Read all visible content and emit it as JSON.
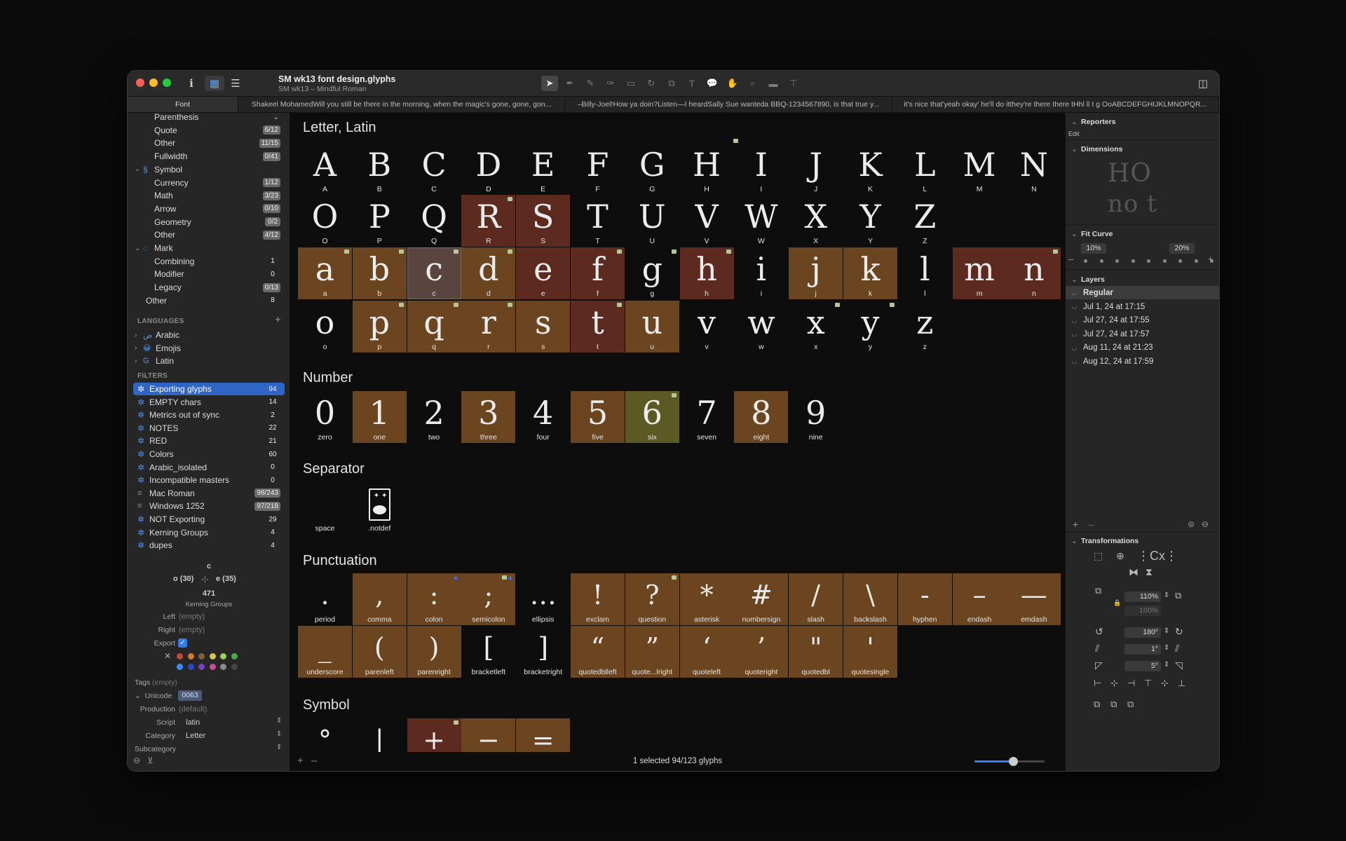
{
  "window": {
    "title": "SM wk13 font design.glyphs",
    "subtitle": "SM wk13 – Mindful Roman"
  },
  "tabs": [
    "Font",
    "Shakeel MohamedWill you still be there in the morning, when the magic's gone, gone, gon...",
    "–Billy-Joel!How ya doin?Listen—I heardSally Sue wanteda BBQ-1234567890, is  that true y...",
    "it's nice that'yeah okay' he'll do itthey're there there tHhl ll t g OoABCDEFGHIJKLMNOPQR..."
  ],
  "sidebar": {
    "categories": [
      {
        "label": "Parenthesis",
        "count": ""
      },
      {
        "label": "Quote",
        "count": "6/12"
      },
      {
        "label": "Other",
        "count": "11/15"
      },
      {
        "label": "Fullwidth",
        "count": "0/41"
      },
      {
        "label": "Symbol",
        "count": ""
      },
      {
        "label": "Currency",
        "count": "1/12"
      },
      {
        "label": "Math",
        "count": "3/23"
      },
      {
        "label": "Arrow",
        "count": "0/10"
      },
      {
        "label": "Geometry",
        "count": "0/2"
      },
      {
        "label": "Other",
        "count": "4/12"
      },
      {
        "label": "Mark",
        "count": ""
      },
      {
        "label": "Combining",
        "count": "1"
      },
      {
        "label": "Modifier",
        "count": "0"
      },
      {
        "label": "Legacy",
        "count": "0/13"
      },
      {
        "label": "Other",
        "count": "8"
      }
    ],
    "languages_heading": "LANGUAGES",
    "languages": [
      {
        "label": "Arabic",
        "icon": "ض"
      },
      {
        "label": "Emojis",
        "icon": "😀"
      },
      {
        "label": "Latin",
        "icon": "G"
      }
    ],
    "filters_heading": "FILTERS",
    "filters": [
      {
        "label": "Exporting glyphs",
        "count": "94"
      },
      {
        "label": "EMPTY chars",
        "count": "14"
      },
      {
        "label": "Metrics out of sync",
        "count": "2"
      },
      {
        "label": "NOTES",
        "count": "22"
      },
      {
        "label": "RED",
        "count": "21"
      },
      {
        "label": "Colors",
        "count": "60"
      },
      {
        "label": "Arabic_isolated",
        "count": "0"
      },
      {
        "label": "Incompatible masters",
        "count": "0"
      },
      {
        "label": "Mac Roman",
        "count": "98/243"
      },
      {
        "label": "Windows 1252",
        "count": "97/218"
      },
      {
        "label": "NOT Exporting",
        "count": "29"
      },
      {
        "label": "Kerning Groups",
        "count": "4"
      },
      {
        "label": "dupes",
        "count": "4"
      }
    ]
  },
  "inspector": {
    "glyph_name": "c",
    "left_sidebearing": "o (30)",
    "right_sidebearing": "e (35)",
    "width": "471",
    "kerning_groups": "Kerning Groups",
    "left_label": "Left",
    "left_value": "(empty)",
    "right_label": "Right",
    "right_value": "(empty)",
    "export_label": "Export",
    "tags_label": "Tags",
    "tags_value": "(empty)",
    "unicode_label": "Unicode",
    "unicode_value": "0063",
    "production_label": "Production",
    "production_value": "(default)",
    "script_label": "Script",
    "script_value": "latin",
    "category_label": "Category",
    "category_value": "Letter",
    "subcategory_label": "Subcategory",
    "colors": [
      "#c04a3a",
      "#d27a33",
      "#806040",
      "#d8c544",
      "#9bd05a",
      "#4aa84a",
      "#3a8ef0",
      "#2f45c8",
      "#7c3fc8",
      "#d04a9a",
      "#8a8a8a",
      "#444444"
    ]
  },
  "sections": [
    {
      "title": "Letter, Latin",
      "rows": [
        [
          {
            "g": "A",
            "n": "A"
          },
          {
            "g": "B",
            "n": "B"
          },
          {
            "g": "C",
            "n": "C"
          },
          {
            "g": "D",
            "n": "D"
          },
          {
            "g": "E",
            "n": "E"
          },
          {
            "g": "F",
            "n": "F"
          },
          {
            "g": "G",
            "n": "G"
          },
          {
            "g": "H",
            "n": "H",
            "badge": "note-out"
          },
          {
            "g": "I",
            "n": "I"
          },
          {
            "g": "J",
            "n": "J"
          },
          {
            "g": "K",
            "n": "K"
          },
          {
            "g": "L",
            "n": "L"
          },
          {
            "g": "M",
            "n": "M"
          },
          {
            "g": "N",
            "n": "N"
          }
        ],
        [
          {
            "g": "O",
            "n": "O"
          },
          {
            "g": "P",
            "n": "P"
          },
          {
            "g": "Q",
            "n": "Q"
          },
          {
            "g": "R",
            "n": "R",
            "bg": "#5c2a1e",
            "badge": "note"
          },
          {
            "g": "S",
            "n": "S",
            "bg": "#5c2a1e"
          },
          {
            "g": "T",
            "n": "T"
          },
          {
            "g": "U",
            "n": "U"
          },
          {
            "g": "V",
            "n": "V"
          },
          {
            "g": "W",
            "n": "W"
          },
          {
            "g": "X",
            "n": "X"
          },
          {
            "g": "Y",
            "n": "Y"
          },
          {
            "g": "Z",
            "n": "Z"
          }
        ],
        [
          {
            "g": "a",
            "n": "a",
            "bg": "#6a4520",
            "badge": "note"
          },
          {
            "g": "b",
            "n": "b",
            "bg": "#6a4520",
            "badge": "note"
          },
          {
            "g": "c",
            "n": "c",
            "bg": "#5a4440",
            "badge": "note",
            "selected": true
          },
          {
            "g": "d",
            "n": "d",
            "bg": "#6a4520",
            "badge": "note"
          },
          {
            "g": "e",
            "n": "e",
            "bg": "#5c2a1e"
          },
          {
            "g": "f",
            "n": "f",
            "bg": "#5c2a1e",
            "badge": "note"
          },
          {
            "g": "g",
            "n": "g",
            "badge": "note"
          },
          {
            "g": "h",
            "n": "h",
            "bg": "#5c2a1e",
            "badge": "note"
          },
          {
            "g": "i",
            "n": "i"
          },
          {
            "g": "j",
            "n": "j",
            "bg": "#6a4520"
          },
          {
            "g": "k",
            "n": "k",
            "bg": "#6a4520"
          },
          {
            "g": "l",
            "n": "l"
          },
          {
            "g": "m",
            "n": "m",
            "bg": "#5c2a1e"
          },
          {
            "g": "n",
            "n": "n",
            "bg": "#5c2a1e",
            "badge": "note"
          }
        ],
        [
          {
            "g": "o",
            "n": "o"
          },
          {
            "g": "p",
            "n": "p",
            "bg": "#6a4520",
            "badge": "note"
          },
          {
            "g": "q",
            "n": "q",
            "bg": "#6a4520",
            "badge": "note"
          },
          {
            "g": "r",
            "n": "r",
            "bg": "#6a4520",
            "badge": "note"
          },
          {
            "g": "s",
            "n": "s",
            "bg": "#6a4520"
          },
          {
            "g": "t",
            "n": "t",
            "bg": "#5c2a1e",
            "badge": "note"
          },
          {
            "g": "u",
            "n": "u",
            "bg": "#6a4520"
          },
          {
            "g": "v",
            "n": "v"
          },
          {
            "g": "w",
            "n": "w"
          },
          {
            "g": "x",
            "n": "x",
            "badge": "note"
          },
          {
            "g": "y",
            "n": "y",
            "badge": "note"
          },
          {
            "g": "z",
            "n": "z"
          }
        ]
      ]
    },
    {
      "title": "Number",
      "rows": [
        [
          {
            "g": "0",
            "n": "zero"
          },
          {
            "g": "1",
            "n": "one",
            "bg": "#6a4520"
          },
          {
            "g": "2",
            "n": "two"
          },
          {
            "g": "3",
            "n": "three",
            "bg": "#6a4520"
          },
          {
            "g": "4",
            "n": "four"
          },
          {
            "g": "5",
            "n": "five",
            "bg": "#6a4520"
          },
          {
            "g": "6",
            "n": "six",
            "bg": "#5c5a24",
            "badge": "note"
          },
          {
            "g": "7",
            "n": "seven"
          },
          {
            "g": "8",
            "n": "eight",
            "bg": "#6a4520"
          },
          {
            "g": "9",
            "n": "nine"
          }
        ]
      ]
    },
    {
      "title": "Separator",
      "rows": [
        [
          {
            "g": " ",
            "n": "space"
          },
          {
            "g": "notdef",
            "n": ".notdef"
          }
        ]
      ]
    },
    {
      "title": "Punctuation",
      "rows": [
        [
          {
            "g": ".",
            "n": "period"
          },
          {
            "g": ",",
            "n": "comma",
            "bg": "#6a4520"
          },
          {
            "g": ":",
            "n": "colon",
            "bg": "#6a4520",
            "badge": "blue"
          },
          {
            "g": ";",
            "n": "semicolon",
            "bg": "#6a4520",
            "badge": "both"
          },
          {
            "g": "…",
            "n": "ellipsis"
          },
          {
            "g": "!",
            "n": "exclam",
            "bg": "#6a4520"
          },
          {
            "g": "?",
            "n": "question",
            "bg": "#6a4520",
            "badge": "note"
          },
          {
            "g": "*",
            "n": "asterisk",
            "bg": "#6a4520"
          },
          {
            "g": "#",
            "n": "numbersign",
            "bg": "#6a4520"
          },
          {
            "g": "/",
            "n": "slash",
            "bg": "#6a4520"
          },
          {
            "g": "\\",
            "n": "backslash",
            "bg": "#6a4520"
          },
          {
            "g": "-",
            "n": "hyphen",
            "bg": "#6a4520"
          },
          {
            "g": "–",
            "n": "endash",
            "bg": "#6a4520"
          },
          {
            "g": "—",
            "n": "emdash",
            "bg": "#6a4520"
          }
        ],
        [
          {
            "g": "_",
            "n": "underscore",
            "bg": "#6a4520"
          },
          {
            "g": "(",
            "n": "parenleft",
            "bg": "#6a4520"
          },
          {
            "g": ")",
            "n": "parenright",
            "bg": "#6a4520"
          },
          {
            "g": "[",
            "n": "bracketleft"
          },
          {
            "g": "]",
            "n": "bracketright"
          },
          {
            "g": "“",
            "n": "quotedblleft",
            "bg": "#6a4520"
          },
          {
            "g": "”",
            "n": "quote...lright",
            "bg": "#6a4520"
          },
          {
            "g": "‘",
            "n": "quoteleft",
            "bg": "#6a4520"
          },
          {
            "g": "’",
            "n": "quoteright",
            "bg": "#6a4520"
          },
          {
            "g": "\"",
            "n": "quotedbl",
            "bg": "#6a4520"
          },
          {
            "g": "'",
            "n": "quotesingle",
            "bg": "#6a4520"
          }
        ]
      ]
    },
    {
      "title": "Symbol",
      "rows": [
        [
          {
            "g": "°",
            "n": ""
          },
          {
            "g": "|",
            "n": ""
          },
          {
            "g": "+",
            "n": "",
            "bg": "#5c2a1e",
            "badge": "note"
          },
          {
            "g": "−",
            "n": "",
            "bg": "#6a4520"
          },
          {
            "g": "=",
            "n": "",
            "bg": "#6a4520"
          }
        ]
      ]
    }
  ],
  "status": {
    "text": "1 selected 94/123 glyphs",
    "zoom_level": 0.55
  },
  "right_panel": {
    "reporters": "Reporters",
    "edit": "Edit",
    "dimensions": "Dimensions",
    "fit_curve": "Fit Curve",
    "fit_min": "10%",
    "fit_max": "20%",
    "layers": "Layers",
    "master_layer": "Regular",
    "layer_items": [
      "Jul 1, 24 at 17:15",
      "Jul 27, 24 at 17:55",
      "Jul 27, 24 at 17:57",
      "Aug 11, 24 at 21:23",
      "Aug 12, 24 at 17:59"
    ],
    "transformations": "Transformations",
    "scale_x": "110%",
    "scale_y": "100%",
    "rotate": "180°",
    "slant_x": "1°",
    "slant_y": "5°"
  }
}
